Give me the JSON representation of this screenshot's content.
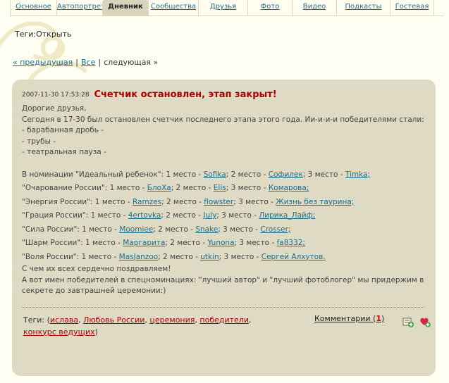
{
  "tabs": [
    {
      "label": "Основное",
      "active": false
    },
    {
      "label": "Автопортрет",
      "active": false
    },
    {
      "label": "Дневник",
      "active": true
    },
    {
      "label": "Сообщества",
      "active": false
    },
    {
      "label": "Друзья",
      "active": false
    },
    {
      "label": "Фото",
      "active": false
    },
    {
      "label": "Видео",
      "active": false
    },
    {
      "label": "Подкасты",
      "active": false
    },
    {
      "label": "Гостевая",
      "active": false
    }
  ],
  "tags_open": "Теги:Открыть",
  "pager": {
    "prev": "« предыдущая",
    "all": "Все",
    "next": "следующая »"
  },
  "entry": {
    "date": "2007-11-30 17:53:28",
    "title": "Счетчик остановлен, этап закрыт!",
    "intro": [
      "Дорогие друзья,",
      "Сегодня в 17-30 был остановлен счетчик последнего этапа этого года. Ии-и-и-и победителями стали:",
      "- барабанная дробь -",
      "- трубы -",
      "- театральная пауза -"
    ],
    "nominations": [
      {
        "name": "В номинации \"Идеальный ребенок\": 1 место - ",
        "p1": "Sofika",
        "m2": "; 2 место - ",
        "p2": "Софилек",
        "m3": "; 3 место - ",
        "p3": "Timka;"
      },
      {
        "name": "\"Очарование России\": 1 место - ",
        "p1": "БлоХа",
        "m2": "; 2 место - ",
        "p2": "Elis",
        "m3": "; 3 место - ",
        "p3": "Комарова;"
      },
      {
        "name": "\"Энергия России\": 1 место - ",
        "p1": "Ramzes",
        "m2": "; 2 место - ",
        "p2": "flowster",
        "m3": "; 3 место - ",
        "p3": "Жизнь без таурина;"
      },
      {
        "name": "\"Грация России\": 1 место - ",
        "p1": "4ertovka",
        "m2": "; 2 место - ",
        "p2": "July",
        "m3": "; 3 место - ",
        "p3": "Лирика_Лайф;"
      },
      {
        "name": "\"Сила России\": 1 место - ",
        "p1": "Moomiee",
        "m2": "; 2 место - ",
        "p2": "Snake",
        "m3": "; 3 место - ",
        "p3": "Crosser;"
      },
      {
        "name": "\"Шарм России\": 1 место - ",
        "p1": "Маргарита",
        "m2": "; 2 место - ",
        "p2": "Yunona",
        "m3": "; 3 место - ",
        "p3": "fa8332;"
      },
      {
        "name": "\"Воля России\": 1 место - ",
        "p1": "MasJanzoo",
        "m2": "; 2 место - ",
        "p2": "utkin",
        "m3": "; 3 место - ",
        "p3": "Сергей Алхутов."
      }
    ],
    "congrats": "С чем их всех сердечно поздравляем!",
    "special": "А вот имен победителей в спецноминациях: \"лучший автор\" и \"лучший фотоблогер\" мы придержим в секрете до завтрашней церемонии:)"
  },
  "footer": {
    "tags_label": "Теги:",
    "tags": [
      "ислава",
      "Любовь России",
      "церемония",
      "победители",
      "конкурс ведущих"
    ],
    "comments_label": "Комментарии (",
    "comments_count": "1",
    "comments_close": ")"
  },
  "icons": {
    "add_comment": "add-comment-icon",
    "add_favorite": "heart-plus-icon"
  },
  "colors": {
    "accent": "#1a6e8c",
    "title": "#aa0000",
    "panel": "#dedac3",
    "tag": "#aa0000"
  }
}
